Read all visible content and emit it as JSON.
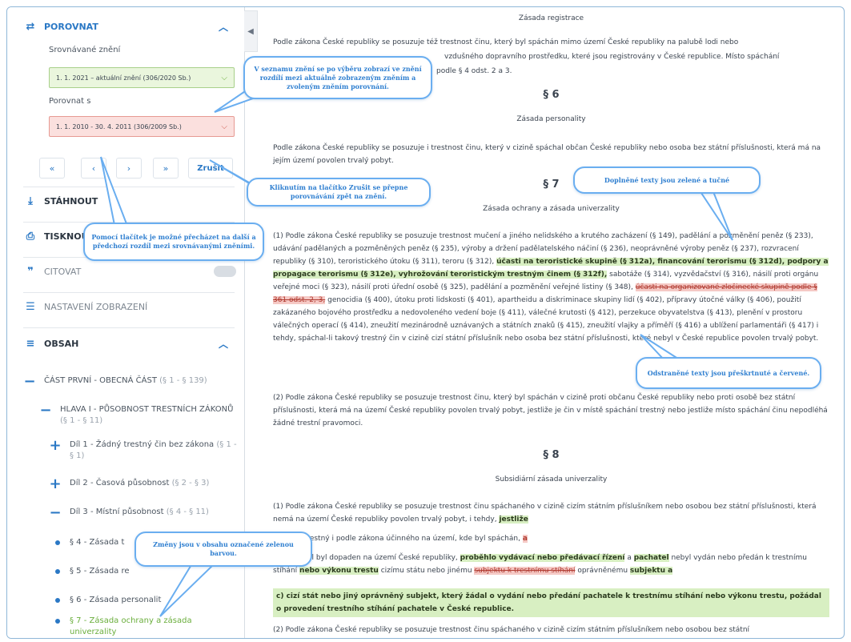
{
  "sidebar": {
    "compare": {
      "title": "POROVNAT",
      "compared_label": "Srovnávané znění",
      "compared_value": "1. 1. 2021 – aktuální znění (306/2020 Sb.)",
      "compare_to_label": "Porovnat s",
      "compare_to_value": "1. 1. 2010 - 30. 4. 2011 (306/2009 Sb.)",
      "nav": {
        "first": "«",
        "prev": "‹",
        "next": "›",
        "last": "»",
        "cancel": "Zrušit"
      }
    },
    "download": "STÁHNOUT",
    "print": "TISKNOUT",
    "cite": "CITOVAT",
    "display_settings": "NASTAVENÍ ZOBRAZENÍ",
    "contents": {
      "title": "OBSAH",
      "items": [
        {
          "label": "ČÁST PRVNÍ - OBECNÁ ČÁST",
          "range": "(§ 1 - § 139)"
        },
        {
          "label": "HLAVA I - PŮSOBNOST TRESTNÍCH ZÁKONŮ",
          "range": "(§ 1 - § 11)"
        },
        {
          "label": "Díl 1 - Žádný trestný čin bez zákona",
          "range": "(§ 1 - § 1)"
        },
        {
          "label": "Díl 2 - Časová působnost",
          "range": "(§ 2 - § 3)"
        },
        {
          "label": "Díl 3 - Místní působnost",
          "range": "(§ 4 - § 11)"
        },
        {
          "label": "§ 4 - Zásada t"
        },
        {
          "label": "§ 5 - Zásada re"
        },
        {
          "label": "§ 6 - Zásada personalit"
        },
        {
          "label": "§ 7 - Zásada ochrany a zásada univerzality"
        }
      ]
    }
  },
  "callouts": {
    "c1": "V seznamu znění se po výběru zobrazí ve znění rozdílí mezi aktuálně zobrazeným zněním a zvoleným zněním porovnání.",
    "c2": "Kliknutím na tlačítko Zrušit se přepne porovnávání zpět na znění.",
    "c3": "Pomocí tlačítek je možné přecházet na další a předchozí rozdíl mezi srovnávanými zněními.",
    "c4": "Doplněné texty jsou zelené a tučné",
    "c5": "Odstraněné texty jsou přeškrtnuté a červené.",
    "c6": "Změny jsou v obsahu označené zelenou barvou."
  },
  "doc": {
    "top_heading": "Zásada registrace",
    "p5": "Podle zákona České republiky se posuzuje též trestnost činu, který byl spáchán mimo území České republiky na palubě lodi nebo",
    "p5b": "vzdušného dopravního prostředku, které jsou registrovány v České republice. Místo spáchání",
    "p5c": "podle § 4 odst. 2 a 3.",
    "s6": "§ 6",
    "s6_title": "Zásada personality",
    "s6_p": "Podle zákona České republiky se posuzuje i trestnost činu, který v cizině spáchal občan České republiky nebo osoba bez státní příslušnosti, která má na jejím území povolen trvalý pobyt.",
    "s7": "§ 7",
    "s7_title": "Zásada ochrany a zásada univerzality",
    "s7_p1_a": "(1) Podle zákona České republiky se posuzuje trestnost mučení a jiného nelidského a krutého zacházení (§ 149), padělání a pozměnění peněz (§ 233), udávání padělaných a pozměněných peněz (§ 235), výroby a držení padělatelského náčiní (§ 236), neoprávněné výroby peněz (§ 237), rozvracení republiky (§ 310), teroristického útoku (§ 311), teroru (§ 312),",
    "s7_g1": "účasti na teroristické skupině (§ 312a), financování terorismu (§ 312d), podpory a propagace terorismu (§ 312e), vyhrožování teroristickým trestným činem (§ 312f),",
    "s7_p1_b": "sabotáže (§ 314), vyzvědačství (§ 316), násilí proti orgánu veřejné moci (§ 323), násilí proti úřední osobě (§ 325), padělání a pozměnění veřejné listiny (§ 348),",
    "s7_r1": "účasti na organizované zločinecké skupině podle § 361 odst. 2, 3,",
    "s7_p1_c": "genocidia (§ 400), útoku proti lidskosti (§ 401), apartheidu a diskriminace skupiny lidí (§ 402), přípravy útočné války (§ 406), použití zakázaného bojového prostředku a nedovoleného vedení boje (§ 411), válečné krutosti (§ 412), perzekuce obyvatelstva (§ 413), plenění v prostoru válečných operací (§ 414), zneužití mezinárodně uznávaných a státních znaků (§ 415), zneužití vlajky a příměří (§ 416) a ublížení parlamentáři (§ 417) i tehdy, spáchal-li takový trestný čin v cizině cizí státní příslušník nebo osoba bez státní příslušnosti, které nebyl v České republice povolen trvalý pobyt.",
    "s7_p2": "(2) Podle zákona České republiky se posuzuje trestnost činu, který byl spáchán v cizině proti občanu České republiky nebo proti osobě bez státní příslušnosti, která má na území České republiky povolen trvalý pobyt, jestliže je čin v místě spáchání trestný nebo jestliže místo spáchání činu nepodléhá žádné trestní pravomoci.",
    "s8": "§ 8",
    "s8_title": "Subsidiární zásada univerzality",
    "s8_p1": "(1) Podle zákona České republiky se posuzuje trestnost činu spáchaného v cizině cizím státním příslušníkem nebo osobou bez státní příslušnosti, která nemá na území České republiky povolen trvalý pobyt, i tehdy,",
    "s8_g_jestlize": "jestliže",
    "s8_a": "a) čin je trestný i podle zákona účinného na území, kde byl spáchán,",
    "s8_r_a": "a",
    "s8_b1": "b) pachatel byl dopaden na území České republiky,",
    "s8_g_b1": "proběhlo vydávací nebo předávací řízení",
    "s8_b2": "a",
    "s8_g_b2": "pachatel",
    "s8_b3": "nebyl vydán nebo předán k trestnímu stíhání",
    "s8_g_b3": "nebo výkonu trestu",
    "s8_b4": "cizímu státu nebo jinému",
    "s8_r_b4": "subjektu k trestnímu stíhání",
    "s8_b5": "oprávněnému",
    "s8_g_b5": "subjektu a",
    "s8_c": "c) cizí stát nebo jiný oprávněný subjekt, který žádal o vydání nebo předání pachatele k trestnímu stíhání nebo výkonu trestu, požádal o provedení trestního stíhání pachatele v České republice.",
    "s8_p2": "(2) Podle zákona České republiky se posuzuje trestnost činu spáchaného v cizině cizím státním příslušníkem nebo osobou bez státní"
  }
}
